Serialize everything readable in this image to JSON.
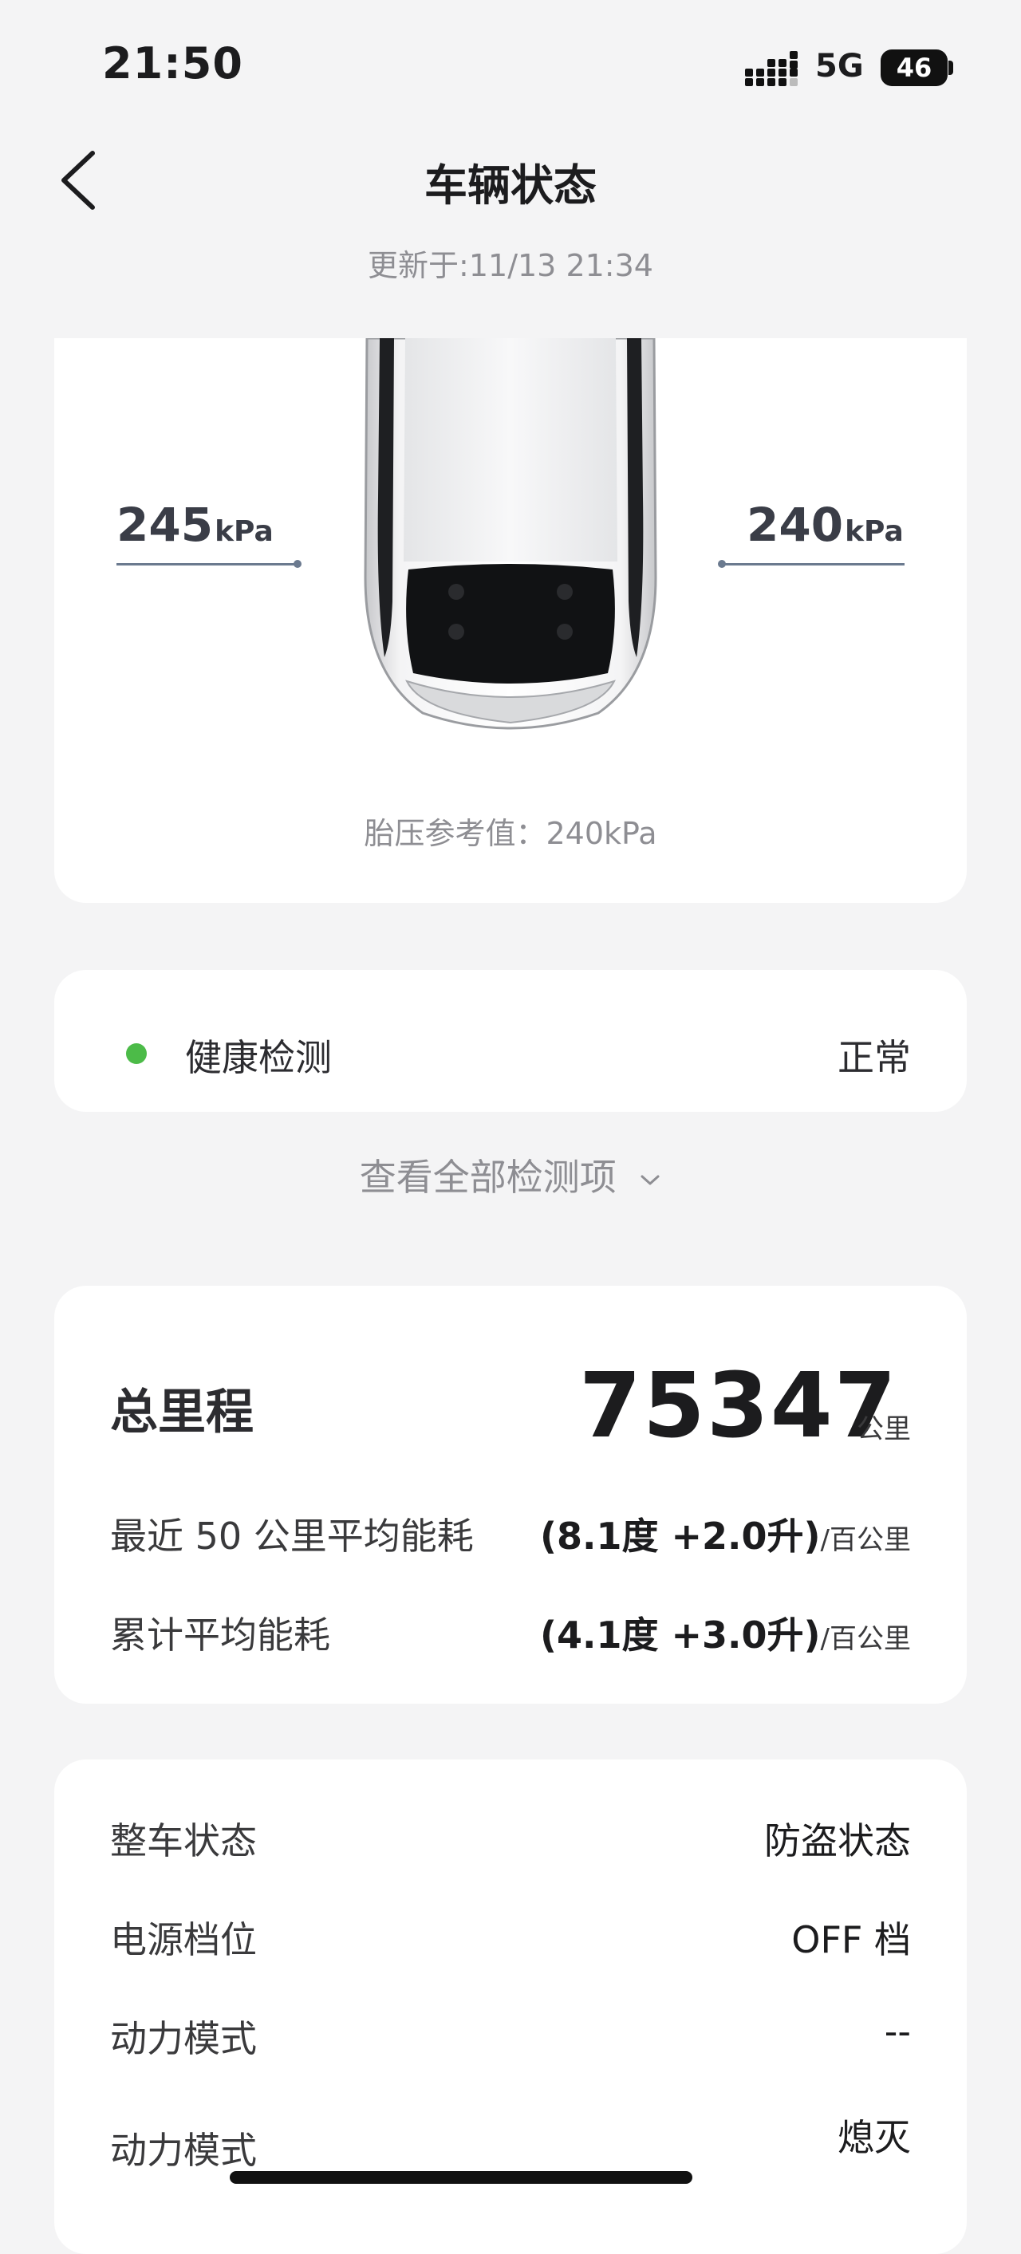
{
  "status_bar": {
    "time": "21:50",
    "network": "5G",
    "battery": "46"
  },
  "header": {
    "title": "车辆状态",
    "update_time": "更新于:11/13 21:34"
  },
  "tyre": {
    "left_value": "245",
    "left_unit": "kPa",
    "right_value": "240",
    "right_unit": "kPa",
    "reference": "胎压参考值：240kPa"
  },
  "health": {
    "label": "健康检测",
    "status": "正常",
    "view_all": "查看全部检测项"
  },
  "mileage": {
    "odometer_label": "总里程",
    "odometer_value": "75347",
    "odometer_unit": "公里",
    "recent_label": "最近 50 公里平均能耗",
    "recent_value": "(8.1度 +2.0升)",
    "recent_unit": "/百公里",
    "total_label": "累计平均能耗",
    "total_value": "(4.1度 +3.0升)",
    "total_unit": "/百公里"
  },
  "vehicle_status": {
    "rows": [
      {
        "label": "整车状态",
        "value": "防盗状态"
      },
      {
        "label": "电源档位",
        "value": "OFF 档"
      },
      {
        "label": "动力模式",
        "value": "--"
      },
      {
        "label": "动力模式",
        "value": "熄灭"
      }
    ]
  },
  "colors": {
    "health_ok": "#4cbb48",
    "background": "#f4f4f5",
    "card": "#ffffff"
  }
}
